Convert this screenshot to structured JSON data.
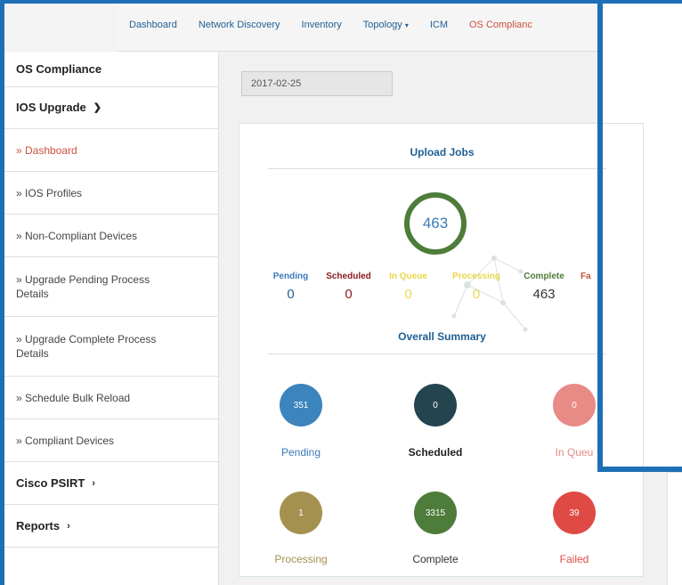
{
  "nav": {
    "items": [
      {
        "label": "Dashboard"
      },
      {
        "label": "Network Discovery"
      },
      {
        "label": "Inventory"
      },
      {
        "label": "Topology"
      },
      {
        "label": "ICM"
      },
      {
        "label": "OS Complianc"
      }
    ]
  },
  "sidebar": {
    "title": "OS Compliance",
    "ios_upgrade": "IOS Upgrade",
    "items": [
      {
        "label": "» Dashboard"
      },
      {
        "label": "» IOS Profiles"
      },
      {
        "label": "» Non-Compliant Devices"
      },
      {
        "label": "» Upgrade Pending Process Details"
      },
      {
        "label": "» Upgrade Complete Process Details"
      },
      {
        "label": "» Schedule Bulk Reload"
      },
      {
        "label": "» Compliant Devices"
      }
    ],
    "cisco_psirt": "Cisco PSIRT",
    "reports": "Reports"
  },
  "main": {
    "date": "2017-02-25",
    "upload_jobs": {
      "title": "Upload Jobs",
      "total": "463",
      "stats": [
        {
          "label": "Pending",
          "value": "0",
          "color": "#3b7ab8"
        },
        {
          "label": "Scheduled",
          "value": "0",
          "color": "#8b1a1a"
        },
        {
          "label": "In Queue",
          "value": "0",
          "color": "#e8d84a"
        },
        {
          "label": "Processing",
          "value": "0",
          "color": "#e8d84a"
        },
        {
          "label": "Complete",
          "value": "463",
          "color": "#4e7c3b"
        },
        {
          "label": "Fa",
          "value": "",
          "color": "#c9513d"
        }
      ]
    },
    "overall_summary": {
      "title": "Overall Summary",
      "items": [
        {
          "label": "Pending",
          "value": "351",
          "color": "#3b84be",
          "label_color": "#3b7ab8"
        },
        {
          "label": "Scheduled",
          "value": "0",
          "color": "#244450",
          "label_color": "#222222"
        },
        {
          "label": "In Queu",
          "value": "0",
          "color": "#e88a85",
          "label_color": "#e88a85"
        },
        {
          "label": "Processing",
          "value": "1",
          "color": "#a5914f",
          "label_color": "#a5914f"
        },
        {
          "label": "Complete",
          "value": "3315",
          "color": "#4e7c3b",
          "label_color": "#333333"
        },
        {
          "label": "Failed",
          "value": "39",
          "color": "#df4b44",
          "label_color": "#df4b44"
        }
      ]
    }
  }
}
